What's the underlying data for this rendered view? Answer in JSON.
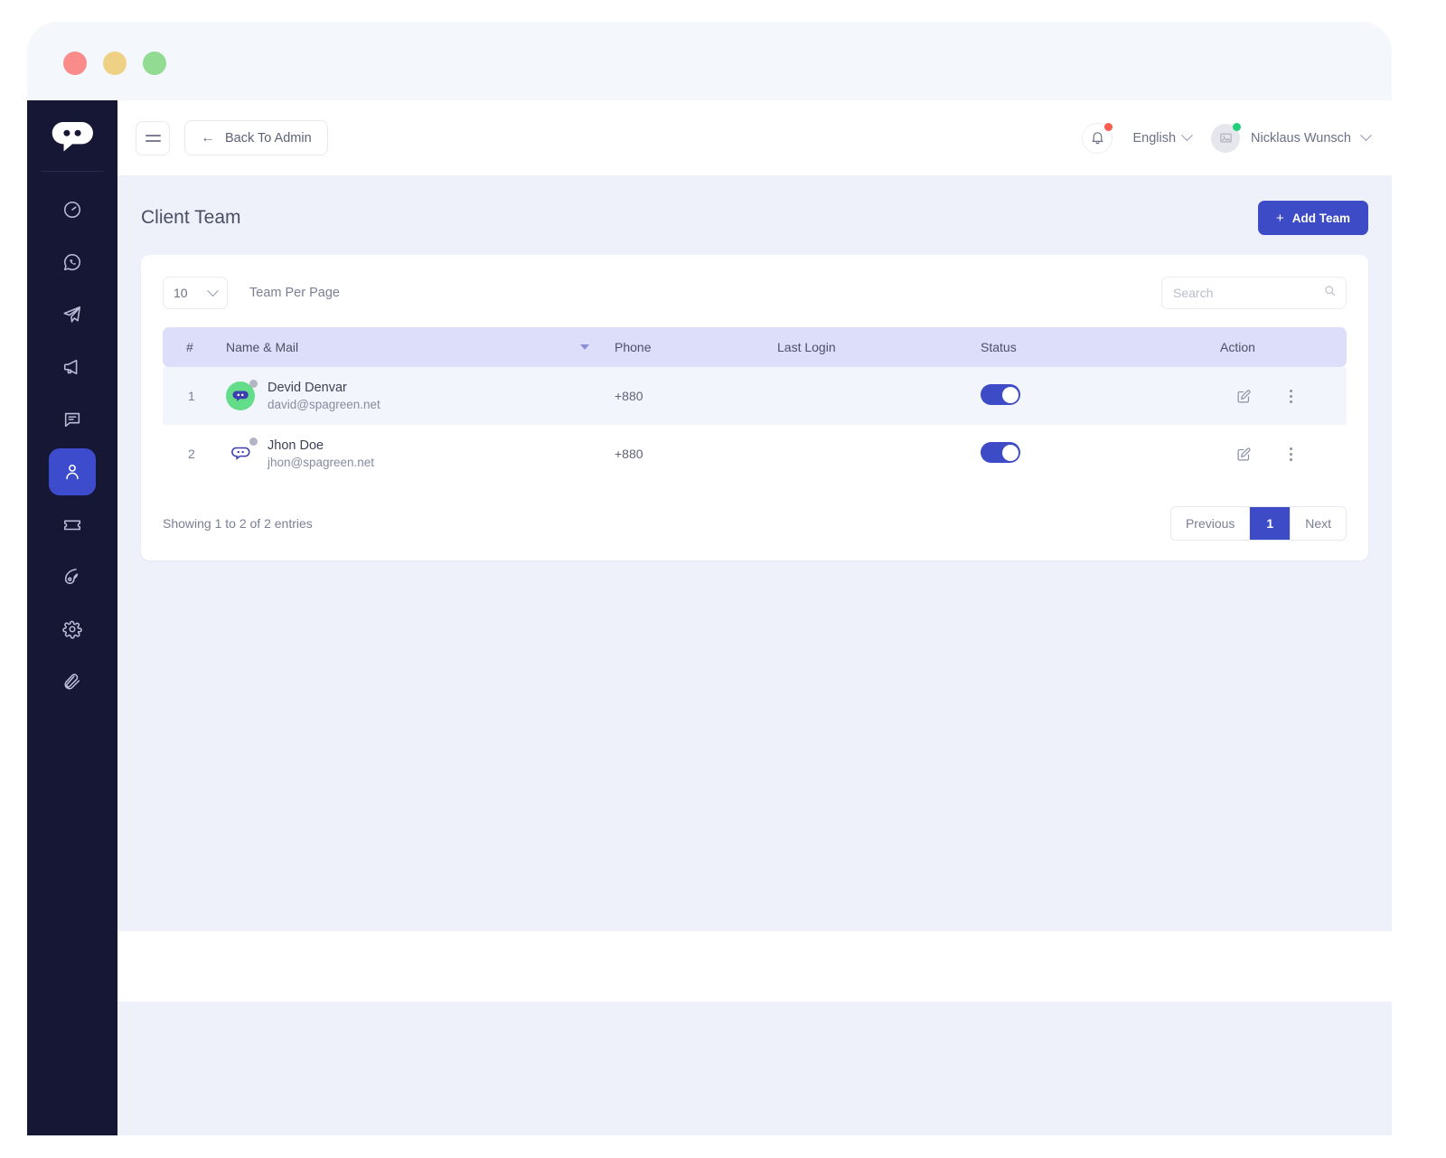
{
  "window": {
    "traffic_lights": [
      "close",
      "minimize",
      "maximize"
    ]
  },
  "sidebar": {
    "brand": "spagreen-bot-logo",
    "items": [
      {
        "icon": "speedometer-icon",
        "name": "dashboard",
        "active": false
      },
      {
        "icon": "whatsapp-icon",
        "name": "whatsapp",
        "active": false
      },
      {
        "icon": "send-icon",
        "name": "telegram",
        "active": false
      },
      {
        "icon": "megaphone-icon",
        "name": "campaign",
        "active": false
      },
      {
        "icon": "chat-icon",
        "name": "messages",
        "active": false
      },
      {
        "icon": "user-icon",
        "name": "team",
        "active": true
      },
      {
        "icon": "ticket-icon",
        "name": "tickets",
        "active": false
      },
      {
        "icon": "pen-nib-icon",
        "name": "design",
        "active": false
      },
      {
        "icon": "gear-icon",
        "name": "settings",
        "active": false
      },
      {
        "icon": "paperclip-icon",
        "name": "attachments",
        "active": false
      }
    ]
  },
  "topbar": {
    "back_label": "Back To Admin",
    "language": "English",
    "user_name": "Nicklaus Wunsch",
    "notification_badge": true,
    "accent_color": "#3d4bc7",
    "notification_dot_color": "#fa5d4b",
    "online_dot_color": "#21d07a"
  },
  "page": {
    "title": "Client Team",
    "add_button_label": "Add Team",
    "add_button_plus": "+"
  },
  "table_controls": {
    "per_page_value": "10",
    "per_page_label": "Team Per Page",
    "search_placeholder": "Search",
    "search_value": ""
  },
  "table": {
    "columns": [
      "#",
      "Name & Mail",
      "Phone",
      "Last Login",
      "Status",
      "Action"
    ],
    "rows": [
      {
        "num": "1",
        "name": "Devid Denvar",
        "mail": "david@spagreen.net",
        "phone": "+880",
        "last_login": "",
        "status_on": true,
        "avatar_bg": "#64dd8a",
        "avatar_style": "green"
      },
      {
        "num": "2",
        "name": "Jhon Doe",
        "mail": "jhon@spagreen.net",
        "phone": "+880",
        "last_login": "",
        "status_on": true,
        "avatar_bg": "transparent",
        "avatar_style": "plain"
      }
    ]
  },
  "footer": {
    "entries_info": "Showing 1 to 2 of 2 entries",
    "pagination": {
      "previous": "Previous",
      "current_page": "1",
      "next": "Next"
    }
  }
}
